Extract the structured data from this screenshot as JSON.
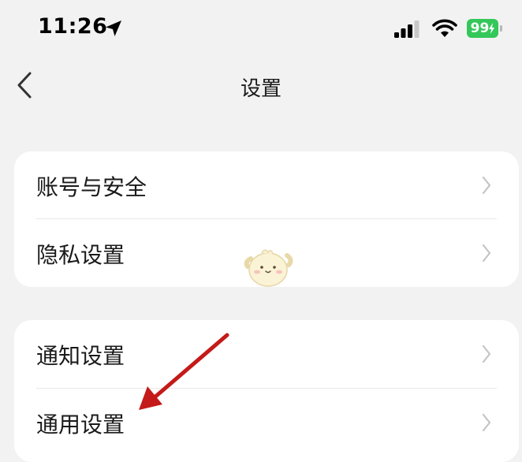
{
  "status_bar": {
    "time": "11:26",
    "battery": "99"
  },
  "nav": {
    "title": "设置"
  },
  "group1": {
    "items": [
      {
        "label": "账号与安全"
      },
      {
        "label": "隐私设置"
      }
    ]
  },
  "group2": {
    "items": [
      {
        "label": "通知设置"
      },
      {
        "label": "通用设置"
      }
    ]
  },
  "annotation": {
    "arrow_color": "#c41a1a"
  }
}
